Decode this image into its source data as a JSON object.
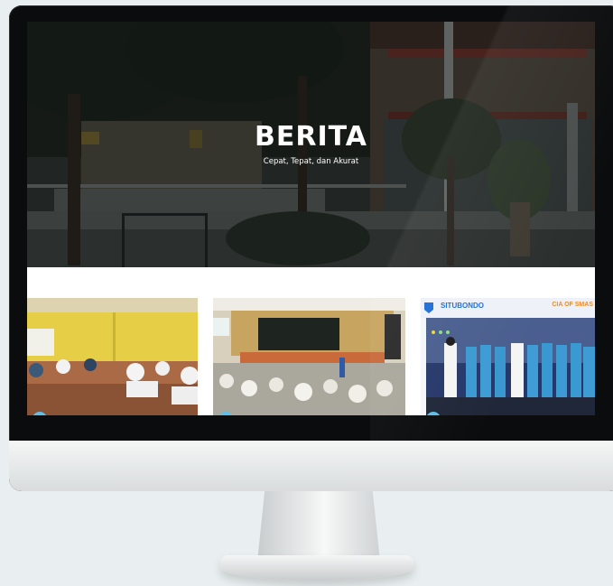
{
  "hero": {
    "title": "BERITA",
    "subtitle": "Cepat, Tepat, dan Akurat"
  },
  "news_cards": [
    {
      "scene": "students-writing-exam-in-classroom"
    },
    {
      "scene": "students-seated-in-hall-facing-stage"
    },
    {
      "scene": "students-in-uniform-lined-up-praying",
      "brand_text": "SITUBONDO",
      "tag_text": "CIA OF SMAS"
    }
  ],
  "colors": {
    "monitor_frame": "#0b0c0d",
    "monitor_chin": "#e6e8e9",
    "background": "#e9eff0",
    "accent_blue": "#1f6fd6",
    "accent_orange": "#f08a24"
  }
}
